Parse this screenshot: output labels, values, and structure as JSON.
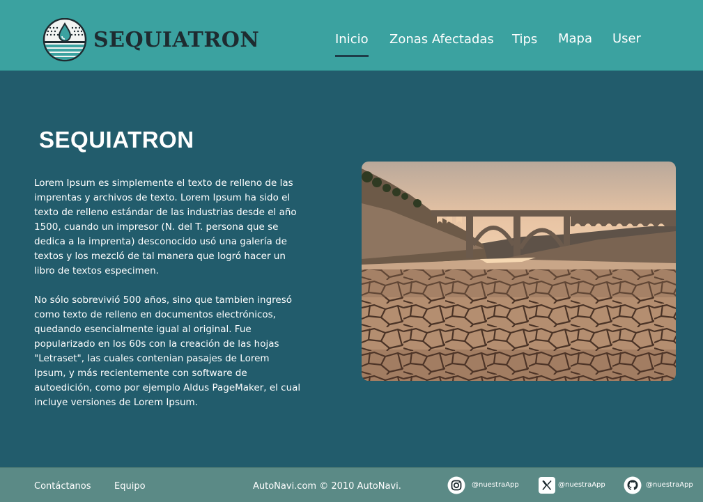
{
  "header": {
    "brand": "SEQUIATRON",
    "logo_icon": "water-drop-logo-icon",
    "nav": [
      {
        "label": "Inicio",
        "active": true
      },
      {
        "label": "Zonas Afectadas",
        "active": false
      },
      {
        "label": "Tips",
        "active": false
      },
      {
        "label": "Mapa",
        "active": false
      },
      {
        "label": "User",
        "active": false
      }
    ]
  },
  "main": {
    "title": "SEQUIATRON",
    "paragraphs": [
      "Lorem Ipsum es simplemente el texto de relleno de las\nimprentas y archivos de texto. Lorem Ipsum ha sido el\ntexto de relleno estándar de las industrias desde el año\n1500, cuando un impresor (N. del T. persona que se\ndedica a la imprenta) desconocido usó una galería de\ntextos y los mezcló de tal manera que logró hacer un\nlibro de textos especimen.",
      "No sólo sobrevivió 500 años, sino que tambien ingresó\ncomo texto de relleno en documentos electrónicos,\nquedando esencialmente igual al original. Fue\npopularizado en los 60s con la creación de las hojas\n\"Letraset\", las cuales contenian pasajes de Lorem\nIpsum, y más recientemente con software de\nautoedición, como por ejemplo Aldus PageMaker, el cual\nincluye versiones de Lorem Ipsum."
    ],
    "hero_image": "drought-cracked-earth-bridge-photo"
  },
  "footer": {
    "links": [
      "Contáctanos",
      "Equipo"
    ],
    "copyright": "AutoNavi.com © 2010 AutoNavi.",
    "social": [
      {
        "icon": "instagram-icon",
        "handle": "@nuestraApp"
      },
      {
        "icon": "x-twitter-icon",
        "handle": "@nuestraApp"
      },
      {
        "icon": "github-icon",
        "handle": "@nuestraApp"
      }
    ]
  },
  "colors": {
    "header_bg": "#3ba2a0",
    "body_bg": "#225c6c",
    "footer_bg": "#5b8a86",
    "brand_text": "#1e2b30"
  }
}
